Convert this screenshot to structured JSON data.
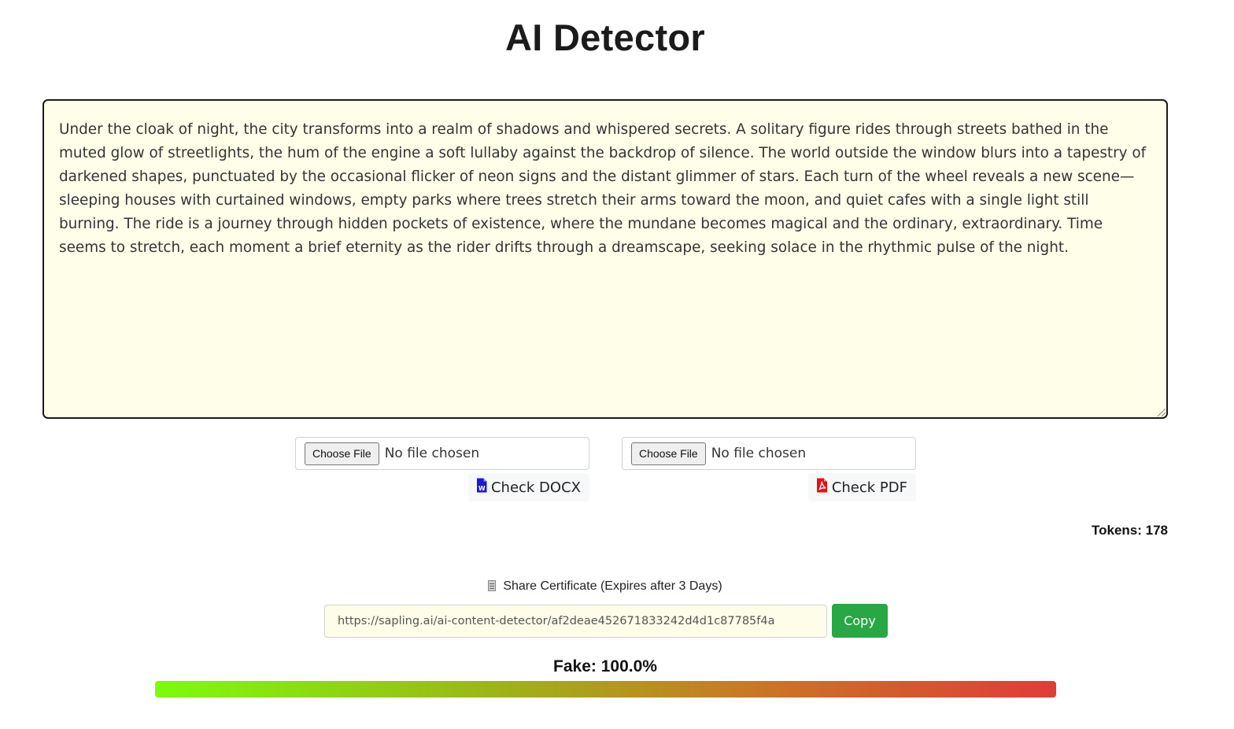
{
  "header": {
    "title": "AI Detector"
  },
  "editor": {
    "text": "Under the cloak of night, the city transforms into a realm of shadows and whispered secrets. A solitary figure rides through streets bathed in the muted glow of streetlights, the hum of the engine a soft lullaby against the backdrop of silence. The world outside the window blurs into a tapestry of darkened shapes, punctuated by the occasional flicker of neon signs and the distant glimmer of stars. Each turn of the wheel reveals a new scene—sleeping houses with curtained windows, empty parks where trees stretch their arms toward the moon, and quiet cafes with a single light still burning. The ride is a journey through hidden pockets of existence, where the mundane becomes magical and the ordinary, extraordinary. Time seems to stretch, each moment a brief eternity as the rider drifts through a dreamscape, seeking solace in the rhythmic pulse of the night.",
    "background": "#fefee9"
  },
  "uploads": {
    "docx": {
      "choose_label": "Choose File",
      "status": "No file chosen",
      "check_label": "Check DOCX",
      "icon": "word-doc-icon",
      "icon_color": "#1a1ad8"
    },
    "pdf": {
      "choose_label": "Choose File",
      "status": "No file chosen",
      "check_label": "Check PDF",
      "icon": "pdf-doc-icon",
      "icon_color": "#e41212"
    }
  },
  "stats": {
    "tokens": "Tokens: 178"
  },
  "share": {
    "label": "Share Certificate (Expires after 3 Days)",
    "icon": "document-icon",
    "url": "https://sapling.ai/ai-content-detector/af2deae452671833242d4d1c87785f4a",
    "copy_label": "Copy",
    "copy_color": "#28a745"
  },
  "result": {
    "label": "Fake: 100.0%",
    "fake_fraction": 1.0,
    "gradient": [
      "#7cfc0c",
      "#e03c38"
    ]
  }
}
